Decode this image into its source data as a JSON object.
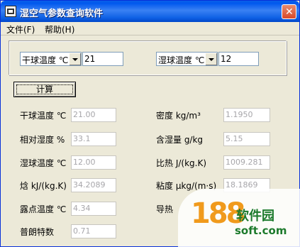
{
  "window": {
    "title": "湿空气参数查询软件"
  },
  "menu": {
    "file": "文件(F)",
    "help": "帮助(H)"
  },
  "inputs": {
    "param1": {
      "selected": "干球温度 ℃",
      "value": "21"
    },
    "param2": {
      "selected": "湿球温度 ℃",
      "value": "12"
    }
  },
  "calc_button": "计算",
  "results": [
    {
      "label": "干球温度 ℃",
      "value": "21.00"
    },
    {
      "label": "相对湿度 %",
      "value": "33.1"
    },
    {
      "label": "湿球温度 ℃",
      "value": "12.00"
    },
    {
      "label": "焓 kJ/(kg.K)",
      "value": "34.2089"
    },
    {
      "label": "露点温度 ℃",
      "value": "4.34"
    },
    {
      "label": "普朗特数",
      "value": "0.71"
    },
    {
      "label": "密度 kg/m³",
      "value": "1.1950"
    },
    {
      "label": "含湿量 g/kg",
      "value": "5.15"
    },
    {
      "label": "比热 J/(kg.K)",
      "value": "1009.281"
    },
    {
      "label": "粘度 μkg/(m·s)",
      "value": "18.1869"
    },
    {
      "label": "导热",
      "value": ""
    }
  ],
  "watermark": {
    "number": "188",
    "brand": "软件园",
    "site": "soft.com"
  }
}
